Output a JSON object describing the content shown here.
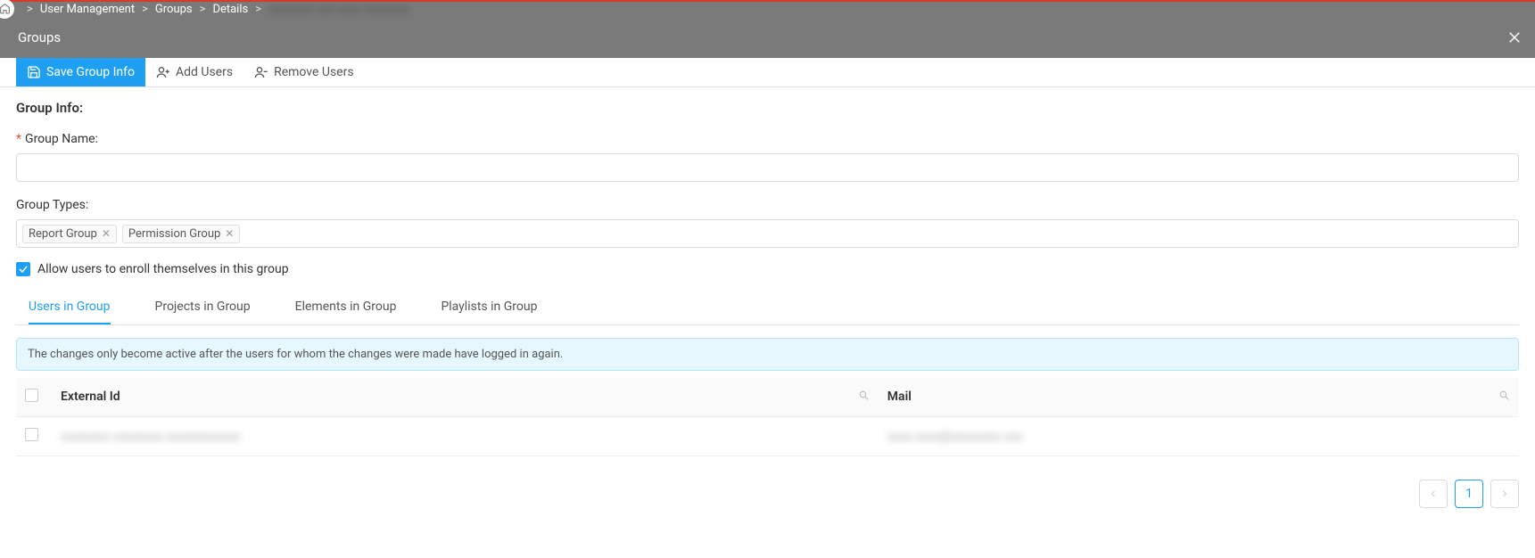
{
  "breadcrumb": {
    "items": [
      "User Management",
      "Groups",
      "Details"
    ],
    "trailing_blur": "xxxxxxxx xxx xxxx xxxxxxxx"
  },
  "subheader": {
    "title": "Groups"
  },
  "toolbar": {
    "save": "Save Group Info",
    "add_users": "Add Users",
    "remove_users": "Remove Users"
  },
  "form": {
    "section_title": "Group Info:",
    "group_name_label": "Group Name:",
    "group_name_value": "",
    "group_types_label": "Group Types:",
    "tags": [
      "Report Group",
      "Permission Group"
    ],
    "allow_enroll_label": "Allow users to enroll themselves in this group",
    "allow_enroll_checked": true
  },
  "tabs": {
    "items": [
      {
        "label": "Users in Group",
        "active": true
      },
      {
        "label": "Projects in Group",
        "active": false
      },
      {
        "label": "Elements in Group",
        "active": false
      },
      {
        "label": "Playlists in Group",
        "active": false
      }
    ]
  },
  "banner": {
    "text": "The changes only become active after the users for whom the changes were made have logged in again."
  },
  "table": {
    "headers": {
      "external_id": "External Id",
      "mail": "Mail"
    },
    "rows": [
      {
        "external_id": "xxxxxxxx.xxxxxxxx.xxxxxxxxxxxx",
        "mail": "xxxx.xxxx@xxxxxxxx.xxx"
      }
    ]
  },
  "pagination": {
    "current": "1"
  }
}
